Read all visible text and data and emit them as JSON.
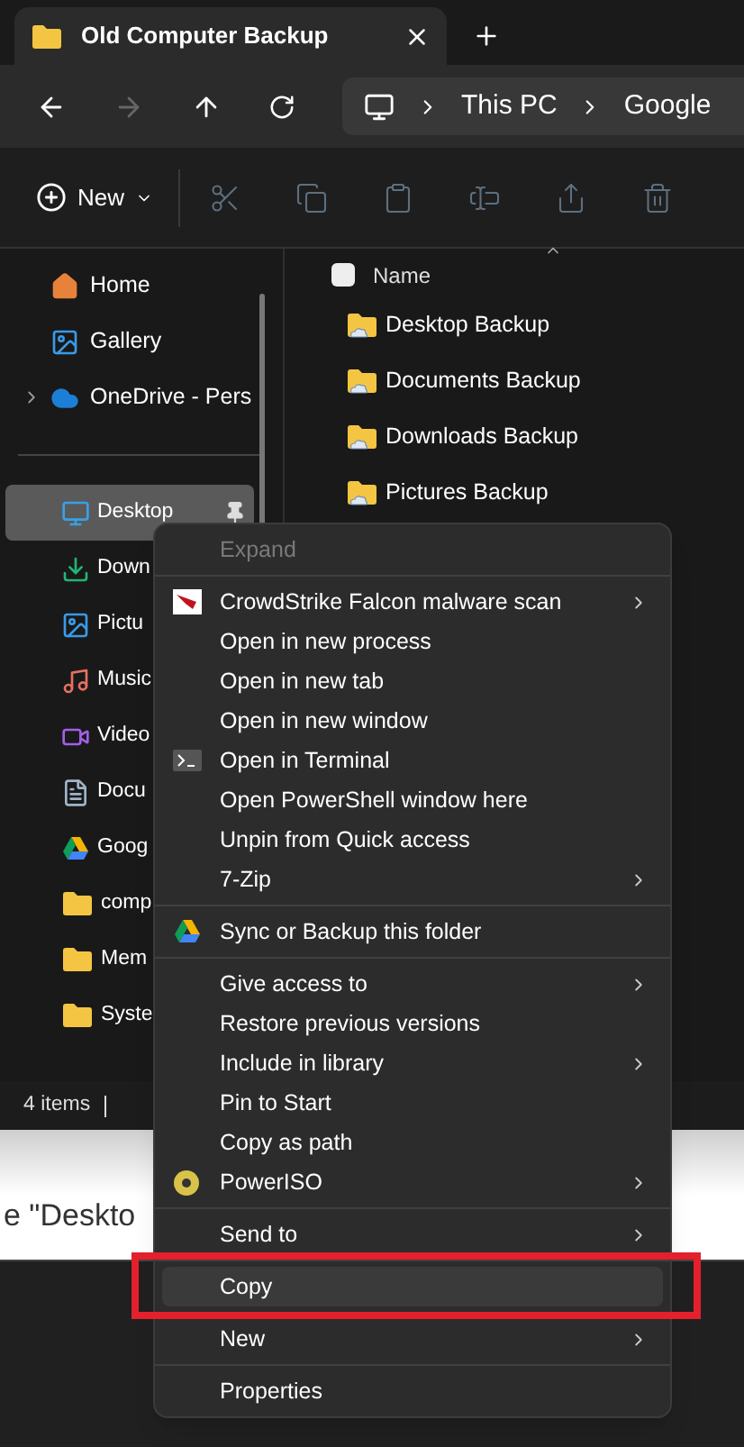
{
  "window": {
    "tab_title": "Old Computer Backup"
  },
  "address_bar": {
    "crumbs": [
      "This PC",
      "Google"
    ]
  },
  "toolbar": {
    "new_label": "New"
  },
  "sidebar": {
    "top_items": [
      {
        "label": "Home",
        "expandable": false
      },
      {
        "label": "Gallery",
        "expandable": false
      },
      {
        "label": "OneDrive - Pers",
        "expandable": true
      }
    ],
    "quick_access": [
      {
        "label": "Desktop",
        "selected": true,
        "pinned": true
      },
      {
        "label": "Down",
        "selected": false,
        "pinned": false
      },
      {
        "label": "Pictu",
        "selected": false,
        "pinned": false
      },
      {
        "label": "Music",
        "selected": false,
        "pinned": false
      },
      {
        "label": "Video",
        "selected": false,
        "pinned": false
      },
      {
        "label": "Docu",
        "selected": false,
        "pinned": false
      },
      {
        "label": "Goog",
        "selected": false,
        "pinned": false
      },
      {
        "label": "comp",
        "selected": false,
        "pinned": false
      },
      {
        "label": "Mem",
        "selected": false,
        "pinned": false
      },
      {
        "label": "Syste",
        "selected": false,
        "pinned": false
      }
    ]
  },
  "file_list": {
    "column": "Name",
    "select_all_checked": false,
    "rows": [
      "Desktop Backup",
      "Documents Backup",
      "Downloads Backup",
      "Pictures Backup"
    ]
  },
  "status_bar": {
    "count": "4 items"
  },
  "page_behind": {
    "text": "e \"Deskto"
  },
  "context_menu": {
    "highlighted": true,
    "groups": [
      [
        {
          "label": "Expand",
          "disabled": true,
          "submenu": false,
          "selected": false
        }
      ],
      [
        {
          "label": "CrowdStrike Falcon malware scan",
          "disabled": false,
          "submenu": true,
          "selected": false
        },
        {
          "label": "Open in new process",
          "disabled": false,
          "submenu": false,
          "selected": false
        },
        {
          "label": "Open in new tab",
          "disabled": false,
          "submenu": false,
          "selected": false
        },
        {
          "label": "Open in new window",
          "disabled": false,
          "submenu": false,
          "selected": false
        },
        {
          "label": "Open in Terminal",
          "disabled": false,
          "submenu": false,
          "selected": false
        },
        {
          "label": "Open PowerShell window here",
          "disabled": false,
          "submenu": false,
          "selected": false
        },
        {
          "label": "Unpin from Quick access",
          "disabled": false,
          "submenu": false,
          "selected": false
        },
        {
          "label": "7-Zip",
          "disabled": false,
          "submenu": true,
          "selected": false
        }
      ],
      [
        {
          "label": "Sync or Backup this folder",
          "disabled": false,
          "submenu": false,
          "selected": false
        }
      ],
      [
        {
          "label": "Give access to",
          "disabled": false,
          "submenu": true,
          "selected": false
        },
        {
          "label": "Restore previous versions",
          "disabled": false,
          "submenu": false,
          "selected": false
        },
        {
          "label": "Include in library",
          "disabled": false,
          "submenu": true,
          "selected": false
        },
        {
          "label": "Pin to Start",
          "disabled": false,
          "submenu": false,
          "selected": false
        },
        {
          "label": "Copy as path",
          "disabled": false,
          "submenu": false,
          "selected": false
        },
        {
          "label": "PowerISO",
          "disabled": false,
          "submenu": true,
          "selected": false
        }
      ],
      [
        {
          "label": "Send to",
          "disabled": false,
          "submenu": true,
          "selected": false
        }
      ],
      [
        {
          "label": "Copy",
          "disabled": false,
          "submenu": false,
          "selected": true
        }
      ],
      [
        {
          "label": "New",
          "disabled": false,
          "submenu": true,
          "selected": false
        }
      ],
      [
        {
          "label": "Properties",
          "disabled": false,
          "submenu": false,
          "selected": false
        }
      ]
    ]
  }
}
